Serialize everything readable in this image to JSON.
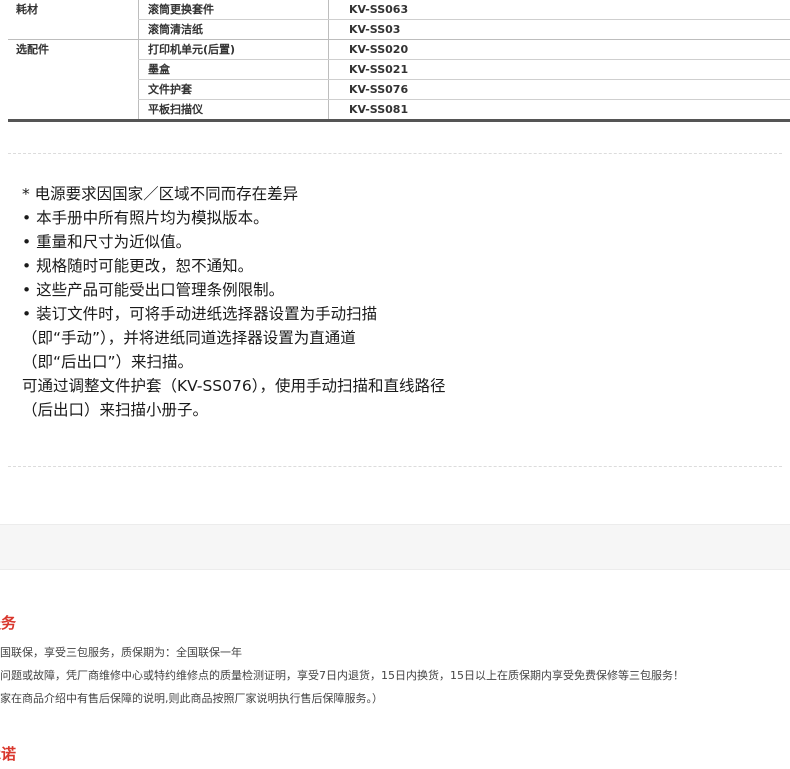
{
  "spec_table": {
    "groups": [
      {
        "category": "耗材",
        "rows": [
          {
            "item": "滚筒更换套件",
            "code": "KV-SS063"
          },
          {
            "item": "滚筒清洁纸",
            "code": "KV-SS03"
          }
        ]
      },
      {
        "category": "选配件",
        "rows": [
          {
            "item": "打印机单元(后置)",
            "code": "KV-SS020"
          },
          {
            "item": "墨盒",
            "code": "KV-SS021"
          },
          {
            "item": "文件护套",
            "code": "KV-SS076"
          },
          {
            "item": "平板扫描仪",
            "code": "KV-SS081"
          }
        ]
      }
    ]
  },
  "notes": [
    "* 电源要求因国家／区域不同而存在差异",
    "• 本手册中所有照片均为模拟版本。",
    "• 重量和尺寸为近似值。",
    "• 规格随时可能更改，恕不通知。",
    "• 这些产品可能受出口管理条例限制。",
    "• 装订文件时，可将手动进纸选择器设置为手动扫描",
    "（即“手动”），并将进纸同道选择器设置为直通道",
    "（即“后出口”）来扫描。",
    "可通过调整文件护套（KV-SS076），使用手动扫描和直线路径",
    "（后出口）来扫描小册子。"
  ],
  "service": {
    "title": "服务",
    "lines": [
      "全国联保，享受三包服务，质保期为：全国联保一年",
      "量问题或故障，凭厂商维修中心或特约维修点的质量检测证明，享受7日内退货，15日内换货，15日以上在质保期内享受免费保修等三包服务！",
      "厂家在商品介绍中有售后保障的说明,则此商品按照厂家说明执行售后保障服务。）"
    ]
  },
  "promise": {
    "title": "承诺"
  }
}
